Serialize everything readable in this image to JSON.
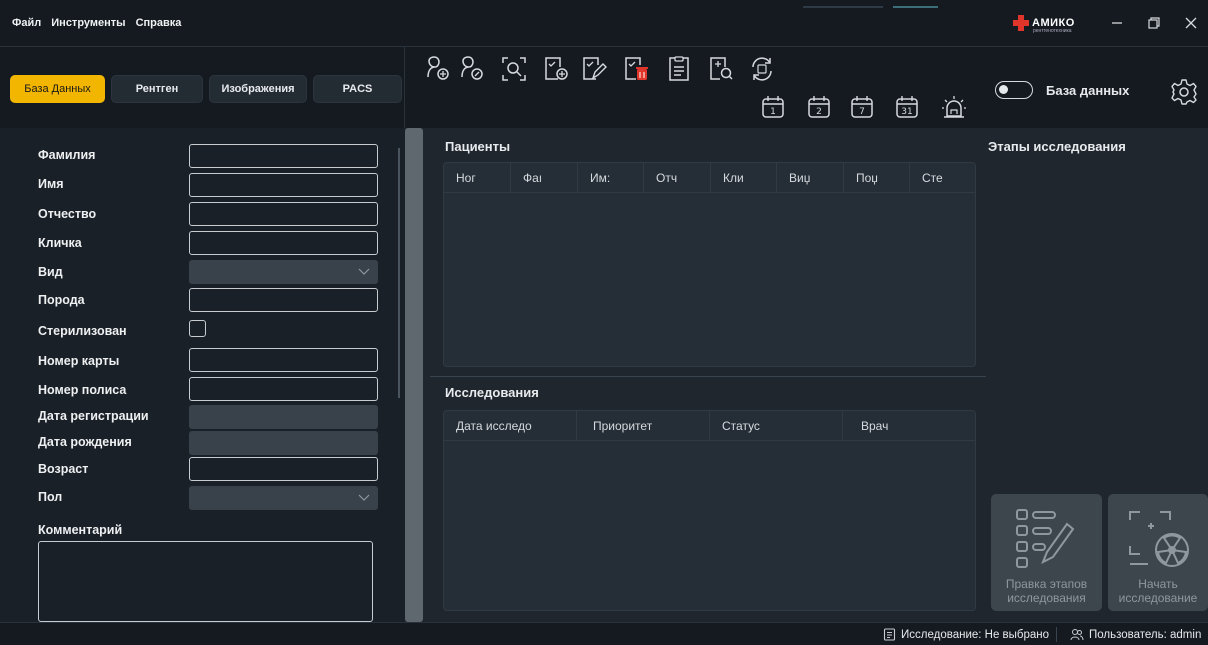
{
  "menu": {
    "file": "Файл",
    "tools": "Инструменты",
    "help": "Справка"
  },
  "logo": {
    "text": "АМИКО",
    "sub": "рентгенотехника"
  },
  "tabs": [
    {
      "label": "База Данных",
      "active": true
    },
    {
      "label": "Рентген"
    },
    {
      "label": "Изображения"
    },
    {
      "label": "PACS"
    }
  ],
  "toolbar": {
    "icons": [
      "add-patient-icon",
      "edit-patient-icon",
      "search-patient-icon",
      "add-study-icon",
      "edit-study-icon",
      "delete-study-icon",
      "report-icon",
      "search-study-icon",
      "sync-icon"
    ],
    "calendar_days": [
      "1",
      "2",
      "7",
      "31"
    ],
    "alarm": "alarm-icon"
  },
  "db_toggle": {
    "label": "База данных",
    "on": false
  },
  "form": {
    "surname": "Фамилия",
    "name": "Имя",
    "patronymic": "Отчество",
    "nickname": "Кличка",
    "species": "Вид",
    "breed": "Порода",
    "sterilized": "Стерилизован",
    "card_number": "Номер карты",
    "policy_number": "Номер полиса",
    "reg_date": "Дата регистрации",
    "birth_date": "Дата рождения",
    "age": "Возраст",
    "sex": "Пол",
    "comment": "Комментарий"
  },
  "patients": {
    "title": "Пациенты",
    "columns": [
      "Нoг",
      "Фаı",
      "Им:",
      "Отч",
      "Кли",
      "Виџ",
      "Поџ",
      "Сте"
    ]
  },
  "studies": {
    "title": "Исследования",
    "columns": [
      "Дата исследо",
      "Приоритет",
      "Статус",
      "Врач"
    ]
  },
  "stages": {
    "title": "Этапы исследования"
  },
  "actions": {
    "edit_stages": [
      "Правка этапов",
      "исследования"
    ],
    "start_study": [
      "Начать",
      "исследование"
    ]
  },
  "status": {
    "study": "Исследование: Не выбрано",
    "user": "Пользователь: admin"
  },
  "colors": {
    "accent": "#f2b500",
    "danger": "#e0352b",
    "bg": "#1f262d"
  }
}
